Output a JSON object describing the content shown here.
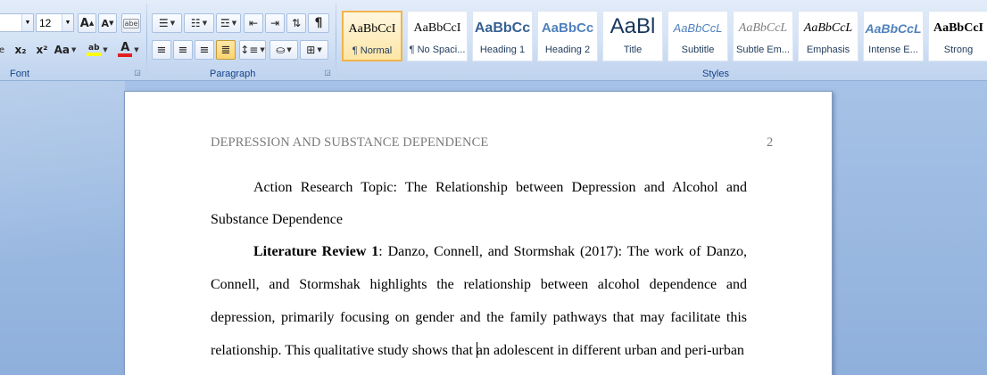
{
  "ribbon": {
    "font_group": {
      "label": "Font",
      "font_size": "12",
      "grow_font_label": "A",
      "shrink_font_label": "A",
      "subscript_label": "x₂",
      "superscript_label": "x²",
      "change_case_label": "Aa",
      "highlight_label": "ab",
      "font_color_label": "A",
      "strike_label": "abe",
      "highlight_color": "#ffff00",
      "font_color": "#e02020"
    },
    "paragraph_group": {
      "label": "Paragraph"
    },
    "styles_group": {
      "label": "Styles",
      "styles": [
        {
          "sample": "AaBbCcI",
          "name": "¶ Normal",
          "selected": true
        },
        {
          "sample": "AaBbCcI",
          "name": "¶ No Spaci..."
        },
        {
          "sample": "AaBbCc",
          "name": "Heading 1"
        },
        {
          "sample": "AaBbCc",
          "name": "Heading 2"
        },
        {
          "sample": "AaBl",
          "name": "Title"
        },
        {
          "sample": "AaBbCcL",
          "name": "Subtitle"
        },
        {
          "sample": "AaBbCcL",
          "name": "Subtle Em..."
        },
        {
          "sample": "AaBbCcL",
          "name": "Emphasis"
        },
        {
          "sample": "AaBbCcL",
          "name": "Intense E..."
        },
        {
          "sample": "AaBbCcI",
          "name": "Strong"
        }
      ]
    }
  },
  "document": {
    "running_head": "DEPRESSION AND SUBSTANCE DEPENDENCE",
    "page_number": "2",
    "topic_line_1": "Action Research Topic: The Relationship between Depression and Alcohol and",
    "topic_line_2": "Substance Dependence",
    "lit_review_label": "Literature Review 1",
    "lit_line_1_rest": ": Danzo, Connell, and Stormshak (2017): The work of Danzo,",
    "lit_line_2": "Connell, and Stormshak highlights the relationship between alcohol dependence and",
    "lit_line_3": "depression, primarily focusing on gender and the family pathways that may facilitate this",
    "lit_line_4_before_caret": "relationship. This qualitative study shows that ",
    "lit_line_4_after_caret": "an adolescent in different urban and peri-urban"
  }
}
